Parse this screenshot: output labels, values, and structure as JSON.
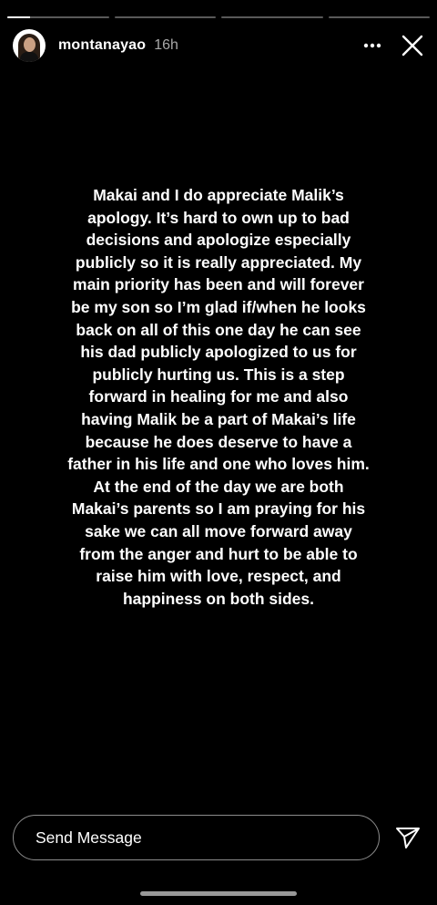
{
  "progress": {
    "segments": [
      {
        "fill": 0.22
      },
      {
        "fill": 0
      },
      {
        "fill": 0
      },
      {
        "fill": 0
      }
    ]
  },
  "header": {
    "username": "montanayao",
    "time": "16h",
    "avatar_icon": "profile-avatar",
    "more_icon": "more-horizontal-icon",
    "close_icon": "close-icon"
  },
  "story": {
    "text": "Makai and I do appreciate Malik’s\napology.  It’s hard to own up to bad\ndecisions and apologize especially\npublicly so it is really appreciated. My\nmain priority has been and will forever\nbe my son so I’m glad if/when he looks\nback on all of this one day he can see\nhis dad publicly apologized to us for\npublicly hurting us. This is a step\nforward in healing for me and also\nhaving Malik be a part of Makai’s life\nbecause he does deserve to have a\nfather in his life and one who loves him.\nAt the end of the day we are both\nMakai’s parents so I am praying for his\nsake we can all move forward away\nfrom the anger and hurt to be able to\nraise him with love, respect, and\nhappiness on both sides."
  },
  "reply": {
    "placeholder": "Send Message",
    "send_icon": "send-icon"
  },
  "colors": {
    "background": "#000000",
    "text": "#ffffff"
  }
}
